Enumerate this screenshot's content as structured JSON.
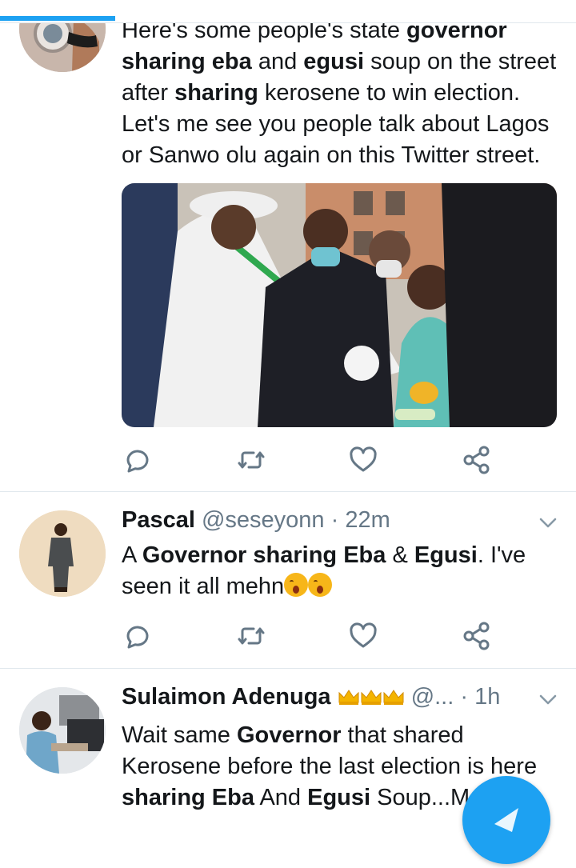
{
  "accent_color": "#1da1f2",
  "progress_fraction": 0.2,
  "tweets": [
    {
      "avatar_icon": "profile-photo",
      "lines": [
        [
          {
            "t": "Here's some people's state ",
            "b": false
          },
          {
            "t": "governor",
            "b": true
          }
        ],
        [
          {
            "t": "sharing eba",
            "b": true
          },
          {
            "t": " and ",
            "b": false
          },
          {
            "t": "egusi",
            "b": true
          },
          {
            "t": " soup on the street",
            "b": false
          }
        ],
        [
          {
            "t": "after ",
            "b": false
          },
          {
            "t": "sharing",
            "b": true
          },
          {
            "t": " kerosene to win  election.",
            "b": false
          }
        ],
        [
          {
            "t": "Let's me see you people talk about Lagos",
            "b": false
          }
        ],
        [
          {
            "t": "or Sanwo olu again on this Twitter street.",
            "b": false
          }
        ]
      ],
      "media_description": "photo-attachment",
      "actions": [
        "reply-icon",
        "retweet-icon",
        "like-icon",
        "share-icon"
      ]
    },
    {
      "name": "Pascal",
      "handle": "@seseyonn",
      "separator": " · ",
      "time": "22m",
      "lines": [
        [
          {
            "t": "A ",
            "b": false
          },
          {
            "t": "Governor sharing Eba",
            "b": true
          },
          {
            "t": " & ",
            "b": false
          },
          {
            "t": "Egusi",
            "b": true
          },
          {
            "t": ". I've",
            "b": false
          }
        ],
        [
          {
            "t": "seen it all mehn",
            "b": false
          }
        ]
      ],
      "emojis": 2,
      "actions": [
        "reply-icon",
        "retweet-icon",
        "like-icon",
        "share-icon"
      ]
    },
    {
      "name": "Sulaimon Adenuga",
      "crowns": 3,
      "handle": "@...",
      "separator": " · ",
      "time": "1h",
      "lines": [
        [
          {
            "t": "Wait same ",
            "b": false
          },
          {
            "t": "Governor",
            "b": true
          },
          {
            "t": " that shared",
            "b": false
          }
        ],
        [
          {
            "t": "Kerosene before the last election is here",
            "b": false
          }
        ],
        [
          {
            "t": "sharing Eba",
            "b": true
          },
          {
            "t": " And ",
            "b": false
          },
          {
            "t": "Egusi",
            "b": true
          },
          {
            "t": " Soup...Ma",
            "b": false
          }
        ]
      ]
    }
  ]
}
